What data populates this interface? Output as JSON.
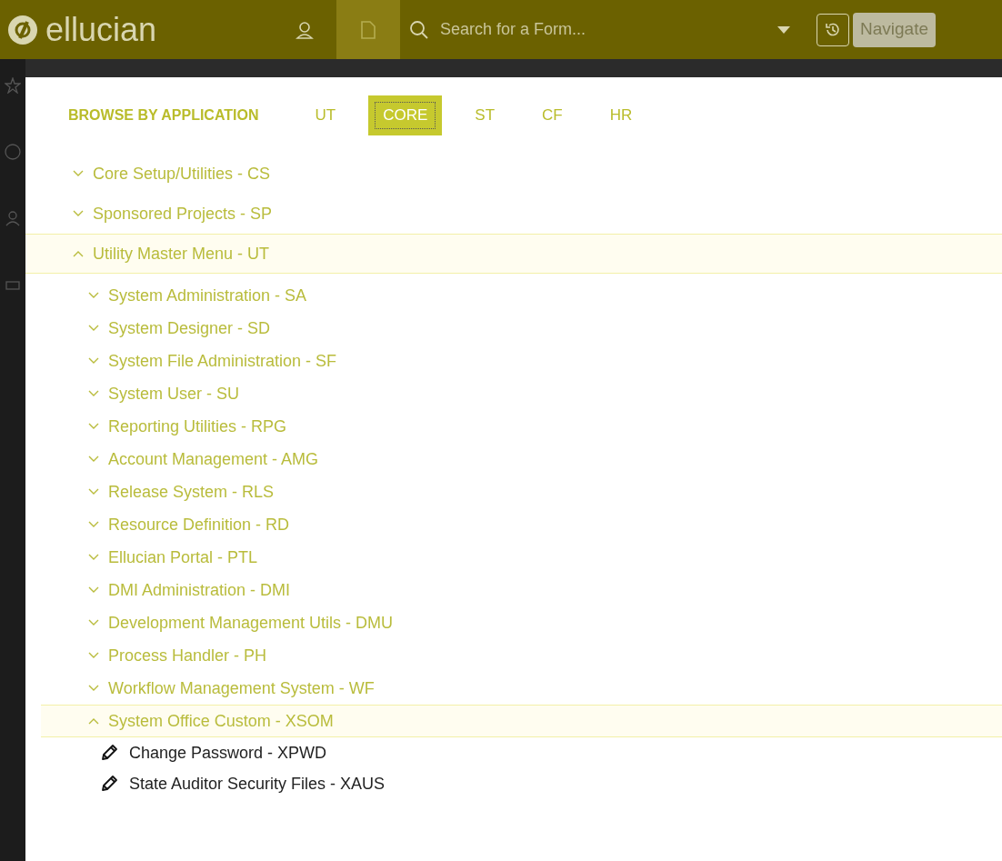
{
  "header": {
    "logo": "ellucian",
    "nav_icons": [
      {
        "kind": "user",
        "selected": false
      },
      {
        "kind": "document",
        "selected": true
      }
    ],
    "search": {
      "placeholder": "Search for a Form..."
    },
    "navigate_button": "Navigate"
  },
  "browse": {
    "heading": "BROWSE BY APPLICATION",
    "tabs": [
      {
        "label": "UT",
        "selected": false
      },
      {
        "label": "CORE",
        "selected": true
      },
      {
        "label": "ST",
        "selected": false
      },
      {
        "label": "CF",
        "selected": false
      },
      {
        "label": "HR",
        "selected": false
      }
    ]
  },
  "tree": [
    {
      "kind": "menu",
      "label": "Core Setup/Utilities - CS",
      "expanded": false
    },
    {
      "kind": "menu",
      "label": "Sponsored Projects - SP",
      "expanded": false
    },
    {
      "kind": "menu",
      "label": "Utility Master Menu - UT",
      "expanded": true,
      "children": [
        {
          "kind": "menu",
          "label": "System Administration - SA",
          "expanded": false
        },
        {
          "kind": "menu",
          "label": "System Designer - SD",
          "expanded": false
        },
        {
          "kind": "menu",
          "label": "System File Administration - SF",
          "expanded": false
        },
        {
          "kind": "menu",
          "label": "System User - SU",
          "expanded": false
        },
        {
          "kind": "menu",
          "label": "Reporting Utilities - RPG",
          "expanded": false
        },
        {
          "kind": "menu",
          "label": "Account Management - AMG",
          "expanded": false
        },
        {
          "kind": "menu",
          "label": "Release System - RLS",
          "expanded": false
        },
        {
          "kind": "menu",
          "label": "Resource Definition - RD",
          "expanded": false
        },
        {
          "kind": "menu",
          "label": "Ellucian Portal - PTL",
          "expanded": false
        },
        {
          "kind": "menu",
          "label": "DMI Administration - DMI",
          "expanded": false
        },
        {
          "kind": "menu",
          "label": "Development Management Utils - DMU",
          "expanded": false
        },
        {
          "kind": "menu",
          "label": "Process Handler - PH",
          "expanded": false
        },
        {
          "kind": "menu",
          "label": "Workflow Management System - WF",
          "expanded": false
        },
        {
          "kind": "menu",
          "label": "System Office Custom - XSOM",
          "expanded": true,
          "children": [
            {
              "kind": "form",
              "label": "Change Password - XPWD"
            },
            {
              "kind": "form",
              "label": "State Auditor Security Files - XAUS"
            }
          ]
        }
      ]
    }
  ]
}
